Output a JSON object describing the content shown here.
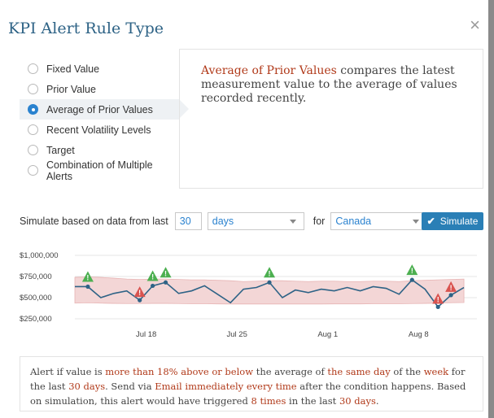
{
  "modal": {
    "title": "KPI Alert Rule Type",
    "close_symbol": "×"
  },
  "options": [
    {
      "label": "Fixed Value",
      "selected": false
    },
    {
      "label": "Prior Value",
      "selected": false
    },
    {
      "label": "Average of Prior Values",
      "selected": true
    },
    {
      "label": "Recent Volatility Levels",
      "selected": false
    },
    {
      "label": "Target",
      "selected": false
    },
    {
      "label": "Combination of Multiple Alerts",
      "selected": false
    }
  ],
  "description": {
    "highlight": "Average of Prior Values",
    "text": " compares the latest measurement value to the average of values recorded recently."
  },
  "simulate": {
    "label": "Simulate based on data from last",
    "count": "30",
    "unit": "days",
    "for_label": "for",
    "region": "Canada",
    "button": "Simulate"
  },
  "chart_data": {
    "type": "line",
    "y_ticks": [
      "$1,000,000",
      "$750,000",
      "$500,000",
      "$250,000"
    ],
    "ylim": [
      250000,
      1000000
    ],
    "x_ticks": [
      {
        "label": "Jul 18",
        "x": 5.5
      },
      {
        "label": "Jul 25",
        "x": 12.5
      },
      {
        "label": "Aug 1",
        "x": 19.5
      },
      {
        "label": "Aug 8",
        "x": 26.5
      }
    ],
    "xlim": [
      0,
      31
    ],
    "series": [
      {
        "values": [
          630000,
          630000,
          500000,
          550000,
          580000,
          470000,
          640000,
          680000,
          550000,
          580000,
          640000,
          540000,
          440000,
          600000,
          620000,
          680000,
          500000,
          590000,
          560000,
          600000,
          580000,
          620000,
          580000,
          630000,
          610000,
          540000,
          710000,
          600000,
          390000,
          530000,
          620000
        ]
      }
    ],
    "band_upper": [
      740000,
      745000,
      740000,
      730000,
      720000,
      715000,
      720000,
      720000,
      715000,
      710000,
      710000,
      705000,
      700000,
      690000,
      695000,
      700000,
      700000,
      695000,
      690000,
      695000,
      695000,
      690000,
      690000,
      695000,
      695000,
      690000,
      700000,
      705000,
      710000,
      715000,
      720000
    ],
    "band_lower": [
      435000,
      440000,
      435000,
      432000,
      430000,
      430000,
      432000,
      432000,
      430000,
      428000,
      428000,
      426000,
      425000,
      425000,
      425000,
      425000,
      425000,
      425000,
      425000,
      425000,
      426000,
      426000,
      426000,
      428000,
      428000,
      428000,
      430000,
      432000,
      435000,
      440000,
      442000
    ],
    "alerts": [
      {
        "i": 1,
        "dir": "up"
      },
      {
        "i": 5,
        "dir": "down"
      },
      {
        "i": 6,
        "dir": "up"
      },
      {
        "i": 7,
        "dir": "up"
      },
      {
        "i": 15,
        "dir": "up"
      },
      {
        "i": 26,
        "dir": "up"
      },
      {
        "i": 28,
        "dir": "down"
      },
      {
        "i": 29,
        "dir": "down"
      }
    ],
    "colors": {
      "line": "#2e6386",
      "band": "#f3d6d6",
      "up": "#4caf50",
      "down": "#d9534f"
    }
  },
  "summary": {
    "p1": "Alert if value is ",
    "h1": "more than 18% above or below",
    "p2": " the average of ",
    "h2": "the same day",
    "p3": " of the ",
    "h3": "week",
    "p4": " for the last ",
    "h4": "30 days",
    "p5": ". Send via ",
    "h5": "Email immediately every time",
    "p6": " after the condition happens. Based on simulation, this alert would have triggered ",
    "h6": "8 times",
    "p7": " in the last ",
    "h7": "30 days",
    "p8": "."
  }
}
